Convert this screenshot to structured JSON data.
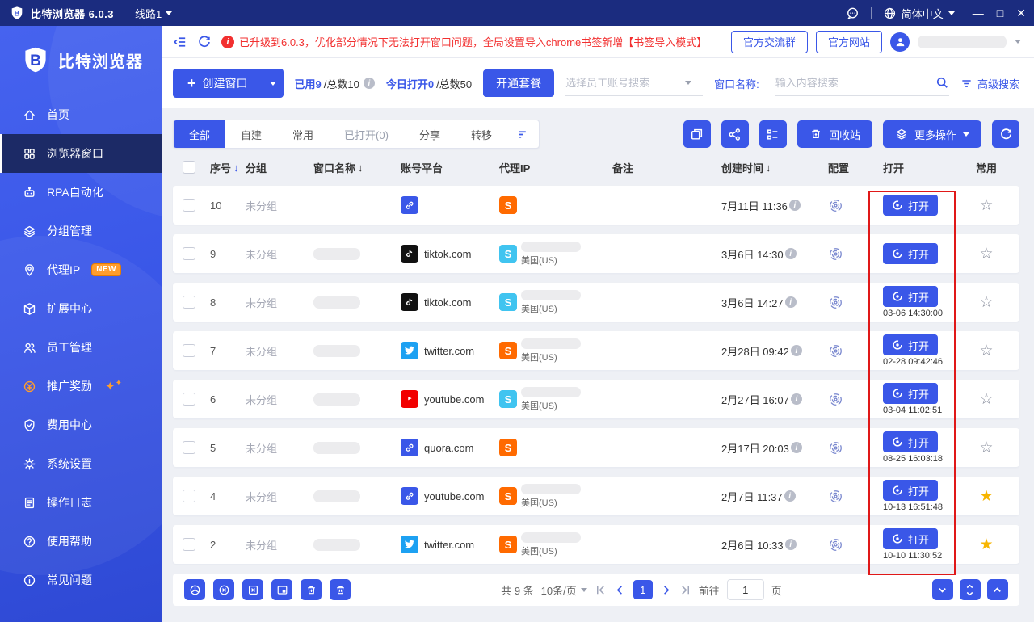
{
  "titlebar": {
    "app_title": "比特浏览器 6.0.3",
    "line": "线路1",
    "language": "简体中文"
  },
  "header": {
    "announcement": "已升级到6.0.3，优化部分情况下无法打开窗口问题，全局设置导入chrome书签新增【书签导入模式】",
    "group_button": "官方交流群",
    "site_button": "官方网站"
  },
  "sidebar": {
    "brand": "比特浏览器",
    "items": [
      {
        "label": "首页",
        "icon": "home"
      },
      {
        "label": "浏览器窗口",
        "icon": "grid",
        "active": true
      },
      {
        "label": "RPA自动化",
        "icon": "robot"
      },
      {
        "label": "分组管理",
        "icon": "layers"
      },
      {
        "label": "代理IP",
        "icon": "pin",
        "badge": "NEW"
      },
      {
        "label": "扩展中心",
        "icon": "box"
      },
      {
        "label": "员工管理",
        "icon": "people"
      },
      {
        "label": "推广奖励",
        "icon": "coin",
        "sparkle": true
      },
      {
        "label": "费用中心",
        "icon": "shield"
      },
      {
        "label": "系统设置",
        "icon": "gear"
      },
      {
        "label": "操作日志",
        "icon": "doc"
      },
      {
        "label": "使用帮助",
        "icon": "help"
      },
      {
        "label": "常见问题",
        "icon": "info"
      }
    ]
  },
  "toolbar": {
    "create_label": "创建窗口",
    "used_label": "已用9",
    "used_total": "/总数10",
    "today_label": "今日打开0",
    "today_total": "/总数50",
    "plan_label": "开通套餐",
    "employee_placeholder": "选择员工账号搜索",
    "window_name_label": "窗口名称:",
    "search_placeholder": "输入内容搜索",
    "advanced_label": "高级搜索"
  },
  "tabs": {
    "items": [
      "全部",
      "自建",
      "常用",
      "已打开(0)",
      "分享",
      "转移"
    ]
  },
  "actions": {
    "recycle_label": "回收站",
    "more_label": "更多操作"
  },
  "table": {
    "headers": {
      "seq": "序号",
      "group": "分组",
      "name": "窗口名称",
      "platform": "账号平台",
      "proxy": "代理IP",
      "note": "备注",
      "created": "创建时间",
      "config": "配置",
      "open": "打开",
      "fav": "常用"
    },
    "open_label": "打开",
    "rows": [
      {
        "seq": "10",
        "group": "未分组",
        "name_redacted": false,
        "platform": "link",
        "domain": "",
        "proxy_color": "orange",
        "country": "",
        "created": "7月11日 11:36",
        "last_open": "",
        "fav": false
      },
      {
        "seq": "9",
        "group": "未分组",
        "name_redacted": true,
        "platform": "tiktok",
        "domain": "tiktok.com",
        "proxy_color": "cyan",
        "country": "美国(US)",
        "created": "3月6日 14:30",
        "last_open": "",
        "fav": false
      },
      {
        "seq": "8",
        "group": "未分组",
        "name_redacted": true,
        "platform": "tiktok",
        "domain": "tiktok.com",
        "proxy_color": "cyan",
        "country": "美国(US)",
        "created": "3月6日 14:27",
        "last_open": "03-06 14:30:00",
        "fav": false
      },
      {
        "seq": "7",
        "group": "未分组",
        "name_redacted": true,
        "platform": "twitter",
        "domain": "twitter.com",
        "proxy_color": "orange",
        "country": "美国(US)",
        "created": "2月28日 09:42",
        "last_open": "02-28 09:42:46",
        "fav": false
      },
      {
        "seq": "6",
        "group": "未分组",
        "name_redacted": true,
        "platform": "youtube",
        "domain": "youtube.com",
        "proxy_color": "cyan",
        "country": "美国(US)",
        "created": "2月27日 16:07",
        "last_open": "03-04 11:02:51",
        "fav": false
      },
      {
        "seq": "5",
        "group": "未分组",
        "name_redacted": true,
        "platform": "link",
        "domain": "quora.com",
        "proxy_color": "orange",
        "country": "",
        "created": "2月17日 20:03",
        "last_open": "08-25 16:03:18",
        "fav": false
      },
      {
        "seq": "4",
        "group": "未分组",
        "name_redacted": true,
        "platform": "link",
        "domain": "youtube.com",
        "proxy_color": "orange",
        "country": "美国(US)",
        "created": "2月7日 11:37",
        "last_open": "10-13 16:51:48",
        "fav": true
      },
      {
        "seq": "2",
        "group": "未分组",
        "name_redacted": true,
        "platform": "twitter",
        "domain": "twitter.com",
        "proxy_color": "orange",
        "country": "美国(US)",
        "created": "2月6日 10:33",
        "last_open": "10-10 11:30:52",
        "fav": true
      }
    ]
  },
  "footer": {
    "total": "共 9 条",
    "page_size": "10条/页",
    "current_page": "1",
    "goto_label": "前往",
    "goto_value": "1",
    "page_unit": "页"
  },
  "colors": {
    "accent": "#3a57e8",
    "titlebar": "#1b2c7f",
    "alert_red": "#f23030",
    "highlight_red": "#e01818",
    "star_gold": "#f7b500",
    "proxy_orange": "#ff6a00",
    "proxy_cyan": "#40c4f0"
  }
}
